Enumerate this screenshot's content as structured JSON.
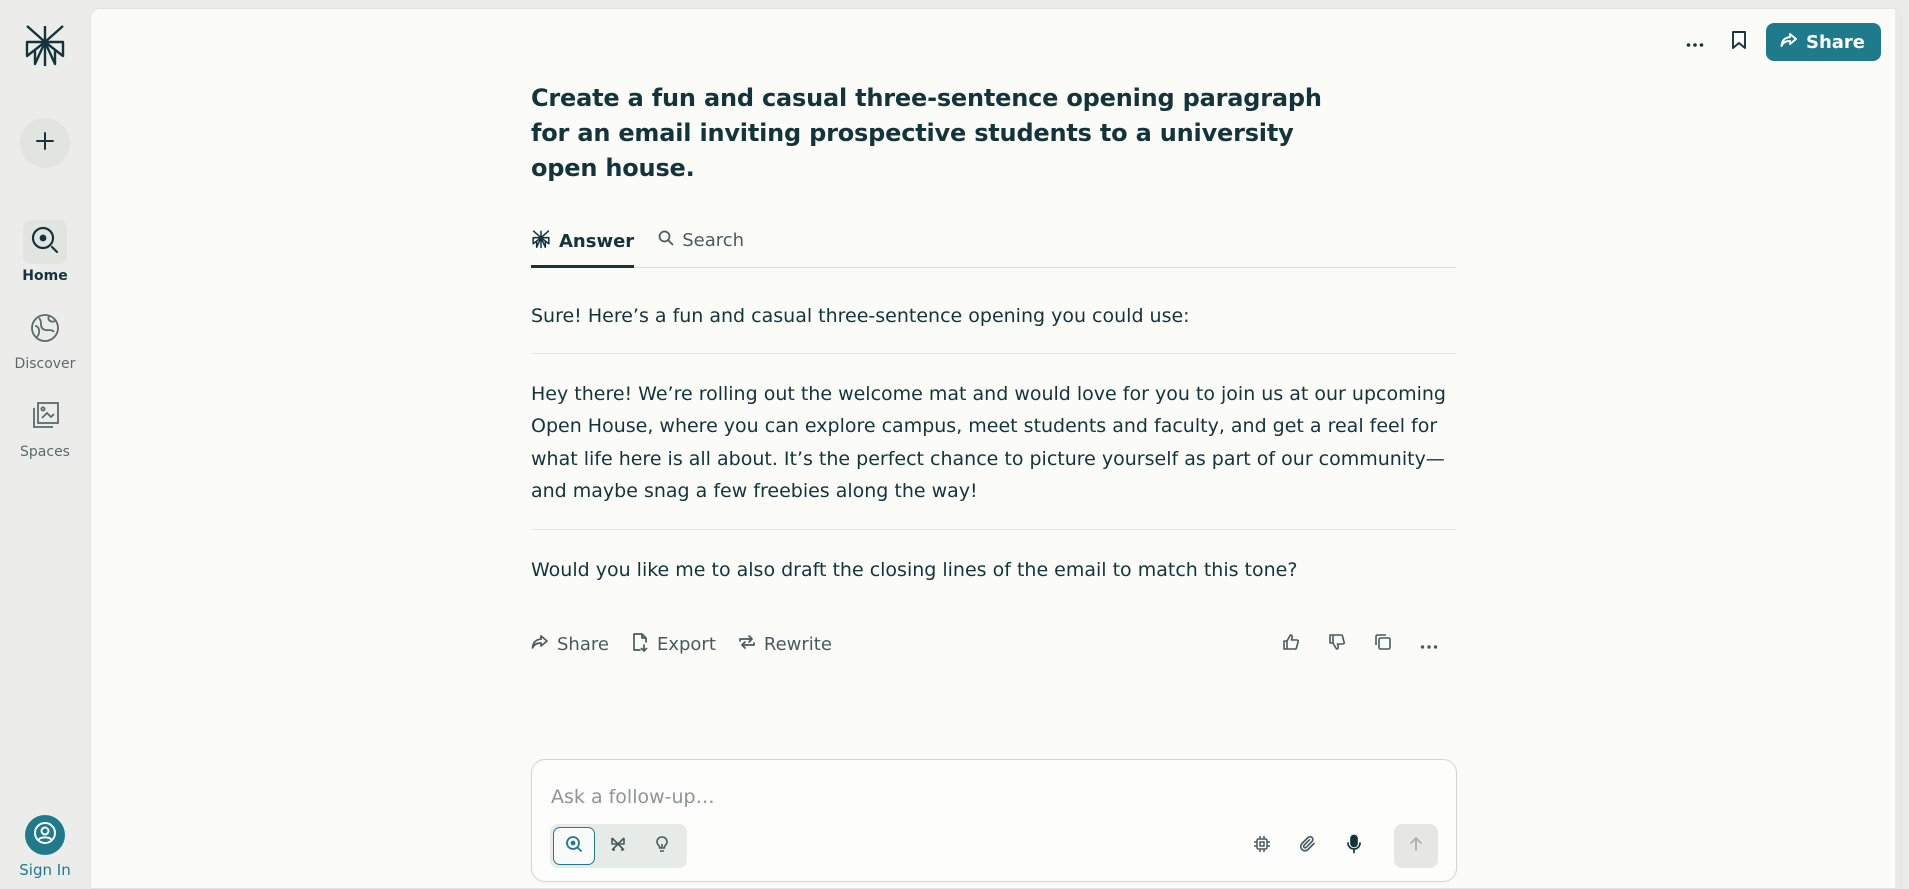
{
  "sidebar": {
    "logo": "perplexity-logo",
    "new_thread_icon": "plus-icon",
    "items": [
      {
        "label": "Home",
        "icon": "home-search-icon",
        "active": true
      },
      {
        "label": "Discover",
        "icon": "globe-icon",
        "active": false
      },
      {
        "label": "Spaces",
        "icon": "spaces-icon",
        "active": false
      }
    ],
    "signin_label": "Sign In"
  },
  "topbar": {
    "more_icon": "ellipsis-icon",
    "bookmark_icon": "bookmark-icon",
    "share_label": "Share"
  },
  "thread": {
    "query": "Create a fun and casual three-sentence opening paragraph for an email inviting prospective students to a university open house.",
    "tabs": [
      {
        "label": "Answer",
        "active": true
      },
      {
        "label": "Search",
        "active": false
      }
    ],
    "answer_paragraphs": [
      "Sure! Here’s a fun and casual three-sentence opening you could use:",
      "Hey there! We’re rolling out the welcome mat and would love for you to join us at our upcoming Open House, where you can explore campus, meet students and faculty, and get a real feel for what life here is all about. It’s the perfect chance to picture yourself as part of our community—and maybe snag a few freebies along the way!",
      "Would you like me to also draft the closing lines of the email to match this tone?"
    ],
    "actions": {
      "share_label": "Share",
      "export_label": "Export",
      "rewrite_label": "Rewrite"
    }
  },
  "followup": {
    "placeholder": "Ask a follow-up…"
  },
  "colors": {
    "accent": "#1f7a8c",
    "text": "#13343b",
    "panel": "#fbfbf7",
    "sidebar": "#ecedea"
  }
}
